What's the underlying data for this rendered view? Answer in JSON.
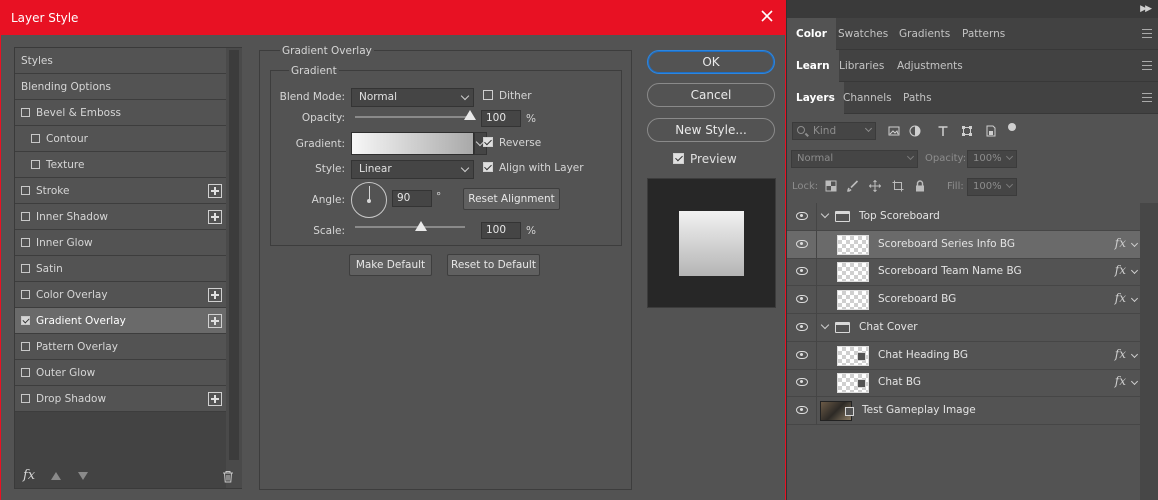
{
  "dialog": {
    "title": "Layer Style",
    "close_icon": "close-icon"
  },
  "styles_list": {
    "items": [
      {
        "label": "Styles",
        "checkbox": false,
        "checked": false,
        "plus": false,
        "indent": false
      },
      {
        "label": "Blending Options",
        "checkbox": false,
        "checked": false,
        "plus": false,
        "indent": false
      },
      {
        "label": "Bevel & Emboss",
        "checkbox": true,
        "checked": false,
        "plus": false,
        "indent": false
      },
      {
        "label": "Contour",
        "checkbox": true,
        "checked": false,
        "plus": false,
        "indent": true
      },
      {
        "label": "Texture",
        "checkbox": true,
        "checked": false,
        "plus": false,
        "indent": true
      },
      {
        "label": "Stroke",
        "checkbox": true,
        "checked": false,
        "plus": true,
        "indent": false
      },
      {
        "label": "Inner Shadow",
        "checkbox": true,
        "checked": false,
        "plus": true,
        "indent": false
      },
      {
        "label": "Inner Glow",
        "checkbox": true,
        "checked": false,
        "plus": false,
        "indent": false
      },
      {
        "label": "Satin",
        "checkbox": true,
        "checked": false,
        "plus": false,
        "indent": false
      },
      {
        "label": "Color Overlay",
        "checkbox": true,
        "checked": false,
        "plus": true,
        "indent": false
      },
      {
        "label": "Gradient Overlay",
        "checkbox": true,
        "checked": true,
        "plus": true,
        "indent": false,
        "selected": true
      },
      {
        "label": "Pattern Overlay",
        "checkbox": true,
        "checked": false,
        "plus": false,
        "indent": false
      },
      {
        "label": "Outer Glow",
        "checkbox": true,
        "checked": false,
        "plus": false,
        "indent": false
      },
      {
        "label": "Drop Shadow",
        "checkbox": true,
        "checked": false,
        "plus": true,
        "indent": false
      }
    ],
    "footer": {
      "fx_label": "fx",
      "up_icon": "arrow-up-icon",
      "down_icon": "arrow-down-icon",
      "trash_icon": "trash-icon"
    }
  },
  "gradient_overlay": {
    "section_title": "Gradient Overlay",
    "group_title": "Gradient",
    "blend_mode": {
      "label": "Blend Mode:",
      "value": "Normal"
    },
    "dither": {
      "label": "Dither",
      "checked": false
    },
    "opacity": {
      "label": "Opacity:",
      "value": "100",
      "unit": "%",
      "level": 1.0
    },
    "gradient": {
      "label": "Gradient:",
      "from": "#f7f7f7",
      "to": "#a9a9a9"
    },
    "reverse": {
      "label": "Reverse",
      "checked": true
    },
    "style": {
      "label": "Style:",
      "value": "Linear"
    },
    "align_with_layer": {
      "label": "Align with Layer",
      "checked": true
    },
    "angle": {
      "label": "Angle:",
      "value": "90",
      "unit": "°"
    },
    "reset_alignment": "Reset Alignment",
    "scale": {
      "label": "Scale:",
      "value": "100",
      "unit": "%",
      "level": 0.6
    },
    "make_default": "Make Default",
    "reset_to_default": "Reset to Default"
  },
  "actions": {
    "ok": "OK",
    "cancel": "Cancel",
    "new_style": "New Style...",
    "preview": {
      "label": "Preview",
      "checked": true
    }
  },
  "panels": {
    "row1_tabs": [
      "Color",
      "Swatches",
      "Gradients",
      "Patterns"
    ],
    "row2_tabs": [
      "Learn",
      "Libraries",
      "Adjustments"
    ],
    "row3_tabs": [
      "Layers",
      "Channels",
      "Paths"
    ],
    "layers": {
      "filter_kind": "Kind",
      "blend_mode": "Normal",
      "opacity_label": "Opacity:",
      "opacity_value": "100%",
      "lock_label": "Lock:",
      "fill_label": "Fill:",
      "fill_value": "100%",
      "rows": [
        {
          "type": "group",
          "name": "Top Scoreboard",
          "fx": false
        },
        {
          "type": "layer",
          "name": "Scoreboard Series Info BG",
          "fx": true,
          "selected": true,
          "indent": true
        },
        {
          "type": "layer",
          "name": "Scoreboard Team Name BG",
          "fx": true,
          "indent": true
        },
        {
          "type": "layer",
          "name": "Scoreboard BG",
          "fx": true,
          "indent": true
        },
        {
          "type": "group",
          "name": "Chat Cover",
          "fx": false
        },
        {
          "type": "layer-mask",
          "name": "Chat Heading BG",
          "fx": true,
          "indent": true
        },
        {
          "type": "layer-mask",
          "name": "Chat BG",
          "fx": true,
          "indent": true
        },
        {
          "type": "photo",
          "name": "Test Gameplay Image",
          "fx": false
        }
      ]
    }
  },
  "colors": {
    "titlebar": "#e81123",
    "accent": "#2c86e0"
  }
}
